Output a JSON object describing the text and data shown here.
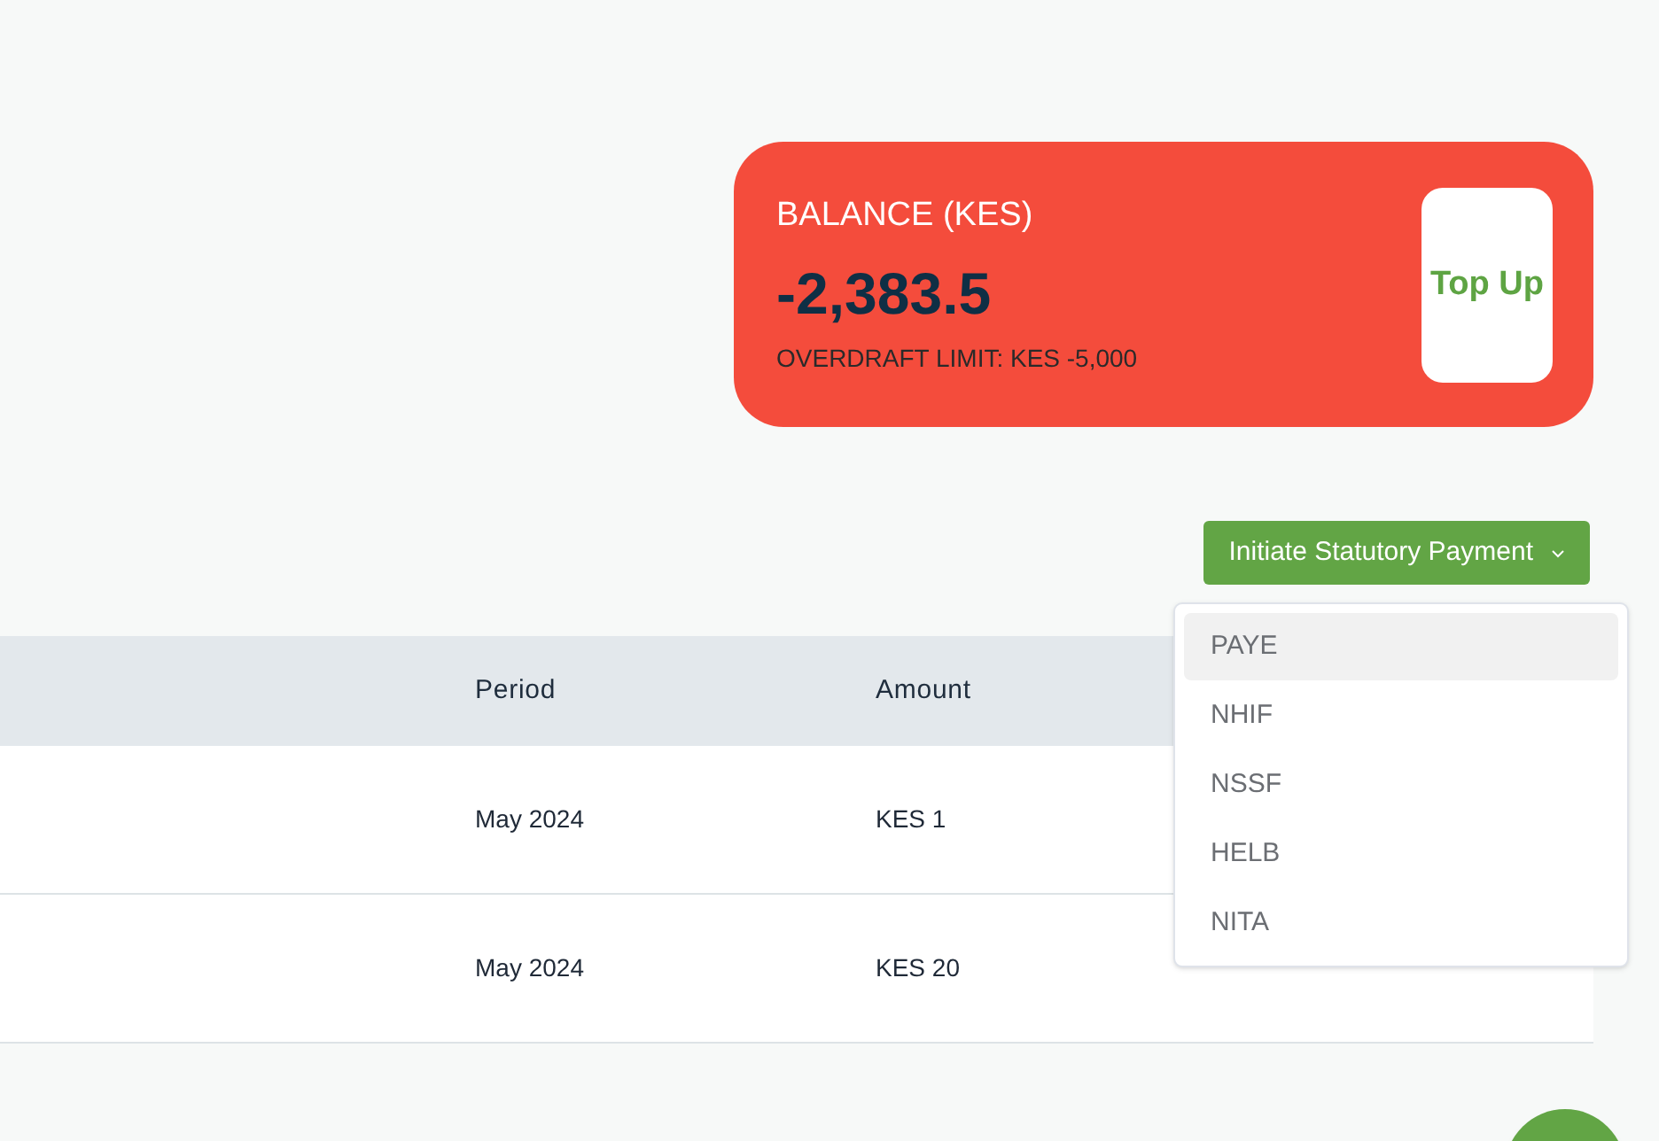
{
  "balance_card": {
    "label": "BALANCE (KES)",
    "amount": "-2,383.5",
    "overdraft": "OVERDRAFT LIMIT: KES -5,000",
    "top_up_button": "Top Up"
  },
  "payment_button": {
    "label": "Initiate Statutory Payment",
    "expanded": true
  },
  "payment_menu": [
    {
      "label": "PAYE",
      "selected": true
    },
    {
      "label": "NHIF",
      "selected": false
    },
    {
      "label": "NSSF",
      "selected": false
    },
    {
      "label": "HELB",
      "selected": false
    },
    {
      "label": "NITA",
      "selected": false
    }
  ],
  "table": {
    "columns": [
      "Period",
      "Amount"
    ],
    "rows": [
      {
        "period": "May 2024",
        "amount": "KES 1"
      },
      {
        "period": "May 2024",
        "amount": "KES 20"
      }
    ]
  }
}
